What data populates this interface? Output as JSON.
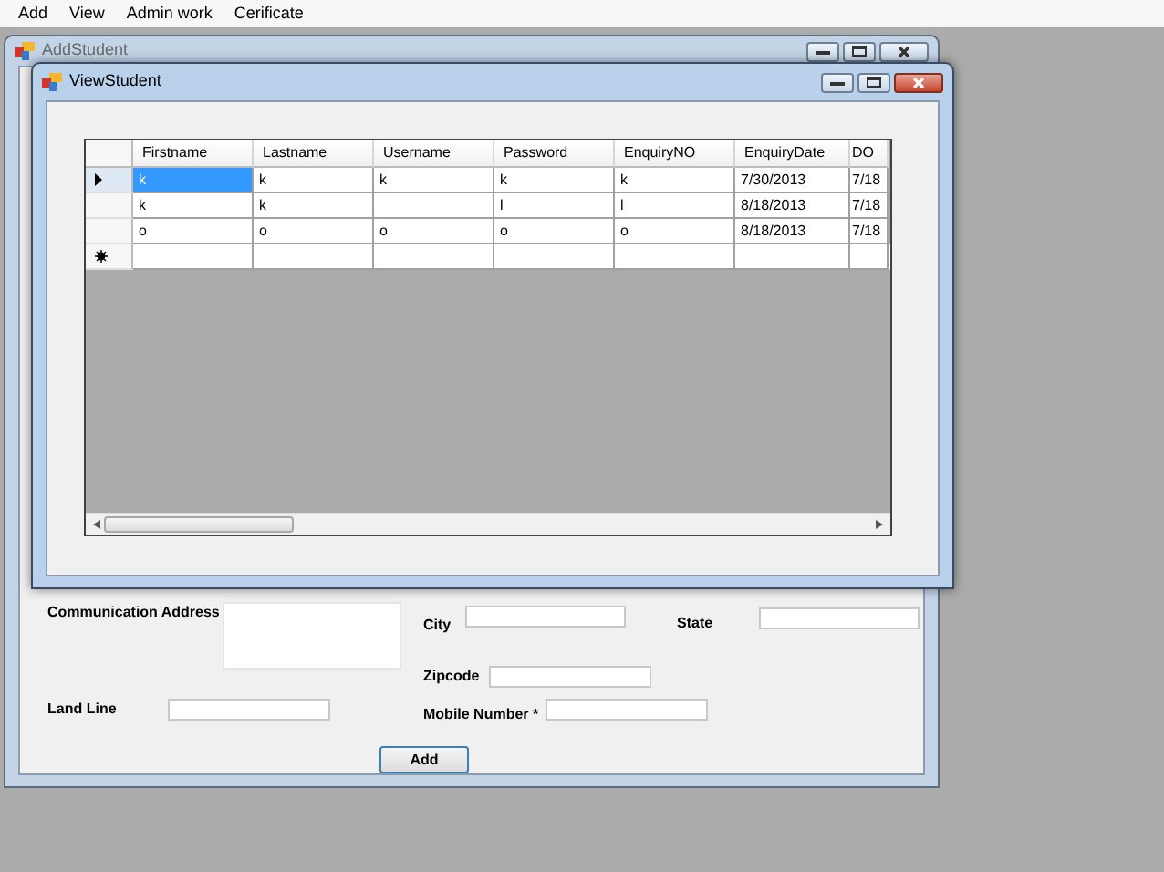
{
  "menu": [
    "Add",
    "View",
    "Admin work",
    "Cerificate"
  ],
  "add_student": {
    "title": "AddStudent",
    "active": false,
    "fields": [
      {
        "label": "Communication Address",
        "kind": "textarea"
      },
      {
        "label": "City",
        "kind": "text"
      },
      {
        "label": "State",
        "kind": "text"
      },
      {
        "label": "Zipcode",
        "kind": "text"
      },
      {
        "label": "Land Line",
        "kind": "text"
      },
      {
        "label": "Mobile Number *",
        "kind": "text"
      }
    ],
    "button": "Add"
  },
  "view_student": {
    "title": "ViewStudent",
    "active": true,
    "grid": {
      "columns": [
        "Firstname",
        "Lastname",
        "Username",
        "Password",
        "EnquiryNO",
        "EnquiryDate",
        "DO"
      ],
      "rows": [
        {
          "kind": "data",
          "current": true,
          "cells": [
            {
              "text": "k",
              "selected": true
            },
            {
              "text": "k",
              "selected": false
            },
            {
              "text": "k",
              "selected": false
            },
            {
              "text": "k",
              "selected": false
            },
            {
              "text": "k",
              "selected": false
            },
            {
              "text": "7/30/2013",
              "selected": false
            },
            {
              "text": "7/18",
              "selected": false
            }
          ]
        },
        {
          "kind": "data",
          "current": false,
          "cells": [
            {
              "text": "k",
              "selected": false
            },
            {
              "text": "k",
              "selected": false
            },
            {
              "selected": false
            },
            {
              "text": "l",
              "selected": false
            },
            {
              "text": "l",
              "selected": false
            },
            {
              "text": "8/18/2013",
              "selected": false
            },
            {
              "text": "7/18",
              "selected": false
            }
          ]
        },
        {
          "kind": "data",
          "current": false,
          "cells": [
            {
              "text": "o",
              "selected": false
            },
            {
              "text": "o",
              "selected": false
            },
            {
              "text": "o",
              "selected": false
            },
            {
              "text": "o",
              "selected": false
            },
            {
              "text": "o",
              "selected": false
            },
            {
              "text": "8/18/2013",
              "selected": false
            },
            {
              "text": "7/18",
              "selected": false
            }
          ]
        },
        {
          "kind": "new",
          "current": false,
          "cells": [
            {
              "selected": false
            },
            {
              "selected": false
            },
            {
              "selected": false
            },
            {
              "selected": false
            },
            {
              "selected": false
            },
            {
              "selected": false
            },
            {
              "selected": false
            }
          ]
        }
      ]
    }
  }
}
